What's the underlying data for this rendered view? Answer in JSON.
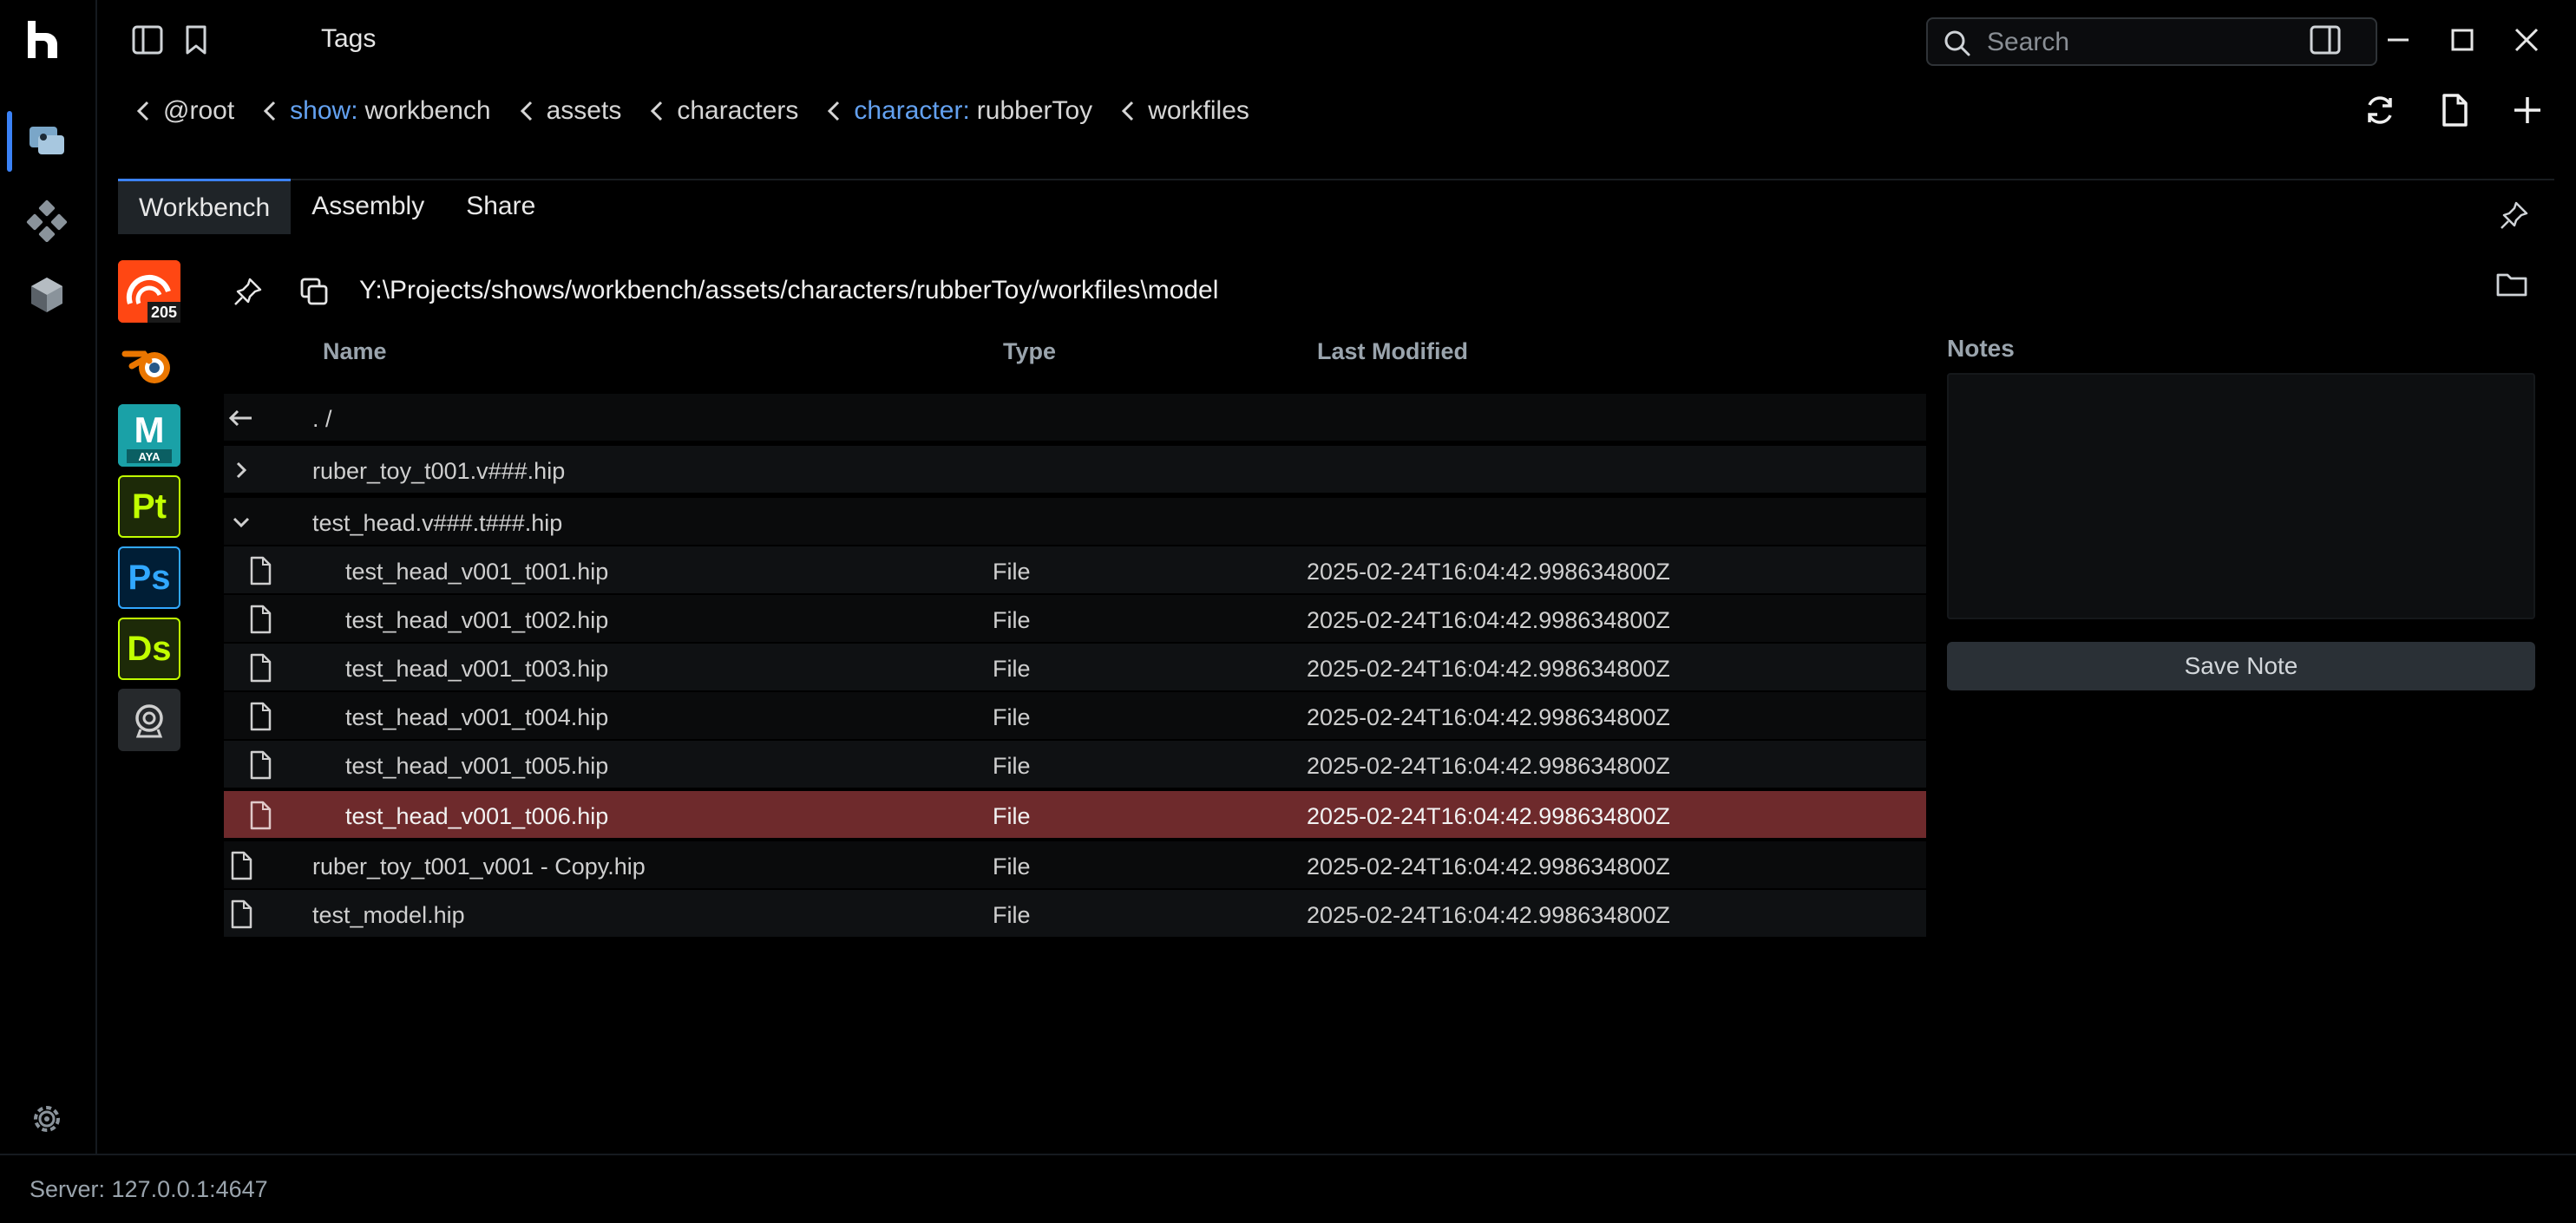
{
  "titlebar": {
    "tags_label": "Tags",
    "search_placeholder": "Search"
  },
  "breadcrumb": [
    {
      "key": "",
      "value": "@root"
    },
    {
      "key": "show:",
      "value": "workbench"
    },
    {
      "key": "",
      "value": "assets"
    },
    {
      "key": "",
      "value": "characters"
    },
    {
      "key": "character:",
      "value": "rubberToy"
    },
    {
      "key": "",
      "value": "workfiles"
    }
  ],
  "tabs": [
    "Workbench",
    "Assembly",
    "Share"
  ],
  "active_tab": "Workbench",
  "apps": [
    {
      "name": "houdini-icon",
      "label": "205",
      "color": "#ff4713"
    },
    {
      "name": "blender-icon",
      "label": "",
      "color": "#ea7600"
    },
    {
      "name": "maya-icon",
      "label": "M",
      "sublabel": "AYA",
      "color": "#1aa1a7"
    },
    {
      "name": "substance-painter-icon",
      "label": "Pt",
      "color": "#c1ff00"
    },
    {
      "name": "photoshop-icon",
      "label": "Ps",
      "color": "#31a8ff"
    },
    {
      "name": "substance-designer-icon",
      "label": "Ds",
      "color": "#c1ff00"
    },
    {
      "name": "custom-app-icon",
      "label": "",
      "color": "#cfcfcf"
    }
  ],
  "path": "Y:\\Projects/shows/workbench/assets/characters/rubberToy/workfiles\\model",
  "table": {
    "headers": {
      "name": "Name",
      "type": "Type",
      "modified": "Last Modified"
    },
    "rows": [
      {
        "kind": "up",
        "name": ". /",
        "type": "",
        "modified": ""
      },
      {
        "kind": "collapsed",
        "name": "ruber_toy_t001.v###.hip",
        "type": "",
        "modified": ""
      },
      {
        "kind": "expanded",
        "name": "test_head.v###.t###.hip",
        "type": "",
        "modified": ""
      },
      {
        "kind": "child",
        "name": "test_head_v001_t001.hip",
        "type": "File",
        "modified": "2025-02-24T16:04:42.998634800Z"
      },
      {
        "kind": "child",
        "name": "test_head_v001_t002.hip",
        "type": "File",
        "modified": "2025-02-24T16:04:42.998634800Z"
      },
      {
        "kind": "child",
        "name": "test_head_v001_t003.hip",
        "type": "File",
        "modified": "2025-02-24T16:04:42.998634800Z"
      },
      {
        "kind": "child",
        "name": "test_head_v001_t004.hip",
        "type": "File",
        "modified": "2025-02-24T16:04:42.998634800Z"
      },
      {
        "kind": "child",
        "name": "test_head_v001_t005.hip",
        "type": "File",
        "modified": "2025-02-24T16:04:42.998634800Z"
      },
      {
        "kind": "child",
        "name": "test_head_v001_t006.hip",
        "type": "File",
        "modified": "2025-02-24T16:04:42.998634800Z",
        "selected": true
      },
      {
        "kind": "file",
        "name": "ruber_toy_t001_v001 - Copy.hip",
        "type": "File",
        "modified": "2025-02-24T16:04:42.998634800Z"
      },
      {
        "kind": "file",
        "name": "test_model.hip",
        "type": "File",
        "modified": "2025-02-24T16:04:42.998634800Z"
      }
    ]
  },
  "notes": {
    "title": "Notes",
    "value": "",
    "save_label": "Save Note"
  },
  "status": {
    "server": "Server: 127.0.0.1:4647"
  },
  "colors": {
    "accent": "#3b82f6",
    "key_blue": "#63a1f0",
    "selected_row": "#6e2a2c"
  }
}
